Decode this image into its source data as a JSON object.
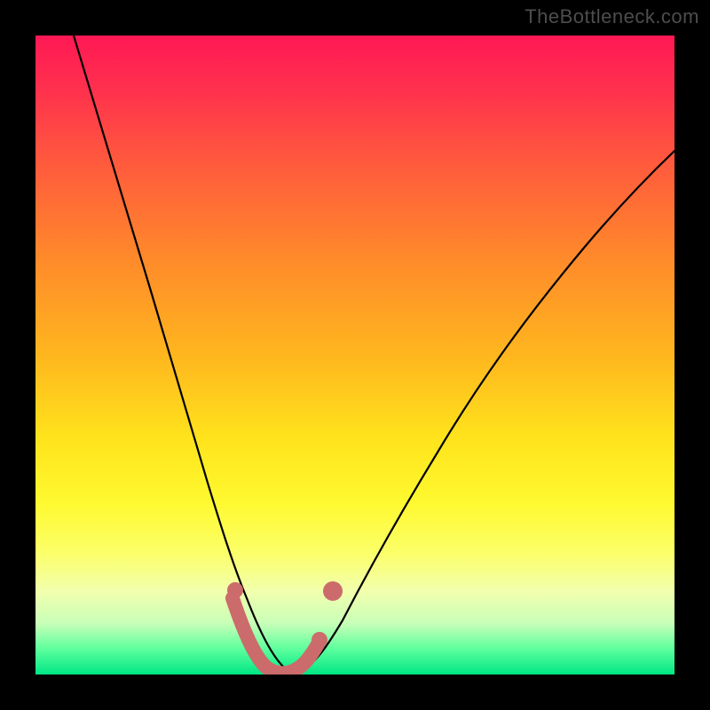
{
  "watermark": "TheBottleneck.com",
  "chart_data": {
    "type": "line",
    "title": "",
    "xlabel": "",
    "ylabel": "",
    "xlim": [
      0,
      100
    ],
    "ylim": [
      0,
      100
    ],
    "grid": false,
    "legend": false,
    "series": [
      {
        "name": "bottleneck-curve",
        "x": [
          6,
          10,
          14,
          18,
          22,
          25,
          27,
          29,
          31,
          33,
          35,
          37,
          39,
          41,
          44,
          48,
          55,
          62,
          70,
          78,
          86,
          94,
          100
        ],
        "values": [
          100,
          87,
          73,
          60,
          46,
          34,
          26,
          19,
          12,
          7,
          3,
          1,
          0,
          1,
          3,
          8,
          17,
          27,
          38,
          49,
          59,
          67,
          72
        ]
      }
    ],
    "annotations": [
      {
        "name": "marker-segment",
        "x": [
          31,
          33,
          35,
          37,
          39,
          41,
          43,
          44
        ],
        "values": [
          12,
          6,
          2,
          0.5,
          0.3,
          1,
          4,
          9
        ]
      },
      {
        "name": "marker-dot",
        "x": 46,
        "value": 13
      }
    ],
    "background_gradient": {
      "stops": [
        {
          "pos": 0,
          "color": "#ff1854"
        },
        {
          "pos": 50,
          "color": "#ffb61e"
        },
        {
          "pos": 80,
          "color": "#fbff69"
        },
        {
          "pos": 100,
          "color": "#00e685"
        }
      ]
    }
  }
}
